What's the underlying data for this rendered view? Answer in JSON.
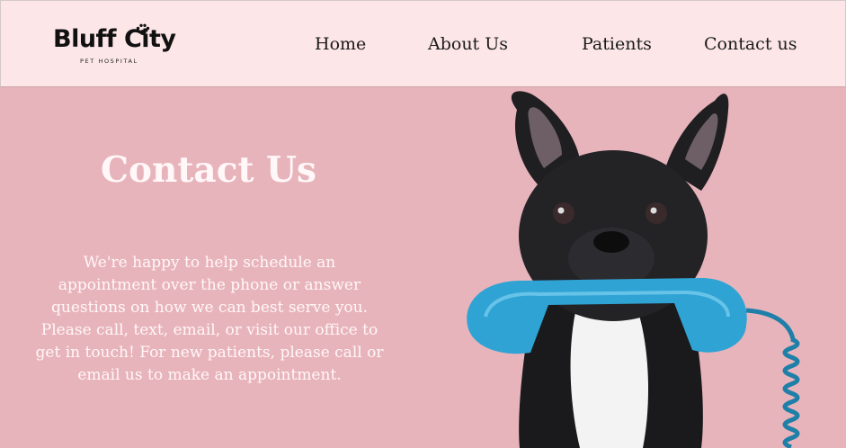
{
  "brand": {
    "name": "Bluff City",
    "tagline": "PET HOSPITAL"
  },
  "nav": {
    "items": [
      {
        "label": "Home"
      },
      {
        "label": "About Us"
      },
      {
        "label": "Patients"
      },
      {
        "label": "Contact us"
      }
    ]
  },
  "hero": {
    "title": "Contact Us",
    "body": "We're happy to help schedule an appointment over the phone or answer questions on how we can best serve you. Please call, text, email, or visit our office to get in touch! For new patients, please call or email us to make an appointment."
  },
  "colors": {
    "header_bg": "#fde6e8",
    "hero_bg": "#e8b4bb",
    "text_light": "#fff7f8",
    "phone_blue": "#2fa3d4"
  }
}
